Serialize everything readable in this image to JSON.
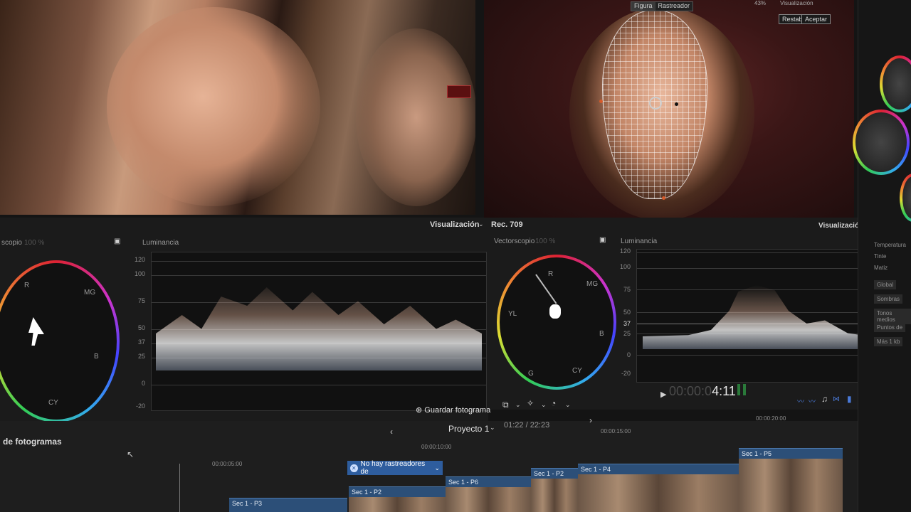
{
  "viewer": {
    "left_pane": {},
    "right_pane": {
      "tabs": [
        "Figura",
        "Rastreador"
      ],
      "zoom": "43%",
      "view_menu": "Visualización",
      "reset_label": "Restabl.",
      "accept_label": "Aceptar"
    }
  },
  "scopes_left": {
    "view_menu": "Visualización",
    "vectorscope_title": "scopio",
    "vectorscope_pct": "100 %",
    "luma_title": "Luminancia",
    "scale": [
      "120",
      "100",
      "75",
      "50",
      "37",
      "25",
      "0",
      "-20"
    ],
    "vector_labels": [
      "R",
      "MG",
      "B",
      "CY"
    ],
    "save_frame": "Guardar fotograma"
  },
  "scopes_right": {
    "colorspace": "Rec. 709",
    "view_menu": "Visualización",
    "vectorscope_title": "Vectorscopio",
    "vectorscope_pct": "100 %",
    "luma_title": "Luminancia",
    "scale": [
      "120",
      "100",
      "75",
      "50",
      "37",
      "25",
      "0",
      "-20"
    ],
    "vector_labels": [
      "R",
      "MG",
      "YL",
      "B",
      "G",
      "CY"
    ],
    "timecode_dim": "00:00:0",
    "timecode_bright": "4:11"
  },
  "timeline": {
    "browser_title": "de fotogramas",
    "project_name": "Proyecto 1",
    "project_time": "01:22 / 22:23",
    "ruler": [
      "00:00:05:00",
      "00:00:10:00",
      "00:00:15:00",
      "00:00:20:00"
    ],
    "tracker_notice": "No hay rastreadores de",
    "clips": [
      "Sec 1 - P3",
      "Sec 1 - P2",
      "Sec 1 - P6",
      "Sec 1 - P2",
      "Sec 1 - P4",
      "Sec 1 - P5"
    ]
  },
  "inspector": {
    "items": [
      "Temperatura",
      "Tinte",
      "Matiz",
      "Global",
      "Sombras",
      "Tonos medios",
      "Puntos de",
      "Más 1 kb"
    ]
  },
  "colors": {
    "accent": "#2c6bd6",
    "clip": "#2c4f78",
    "tracker_badge": "#3a6fc2"
  }
}
